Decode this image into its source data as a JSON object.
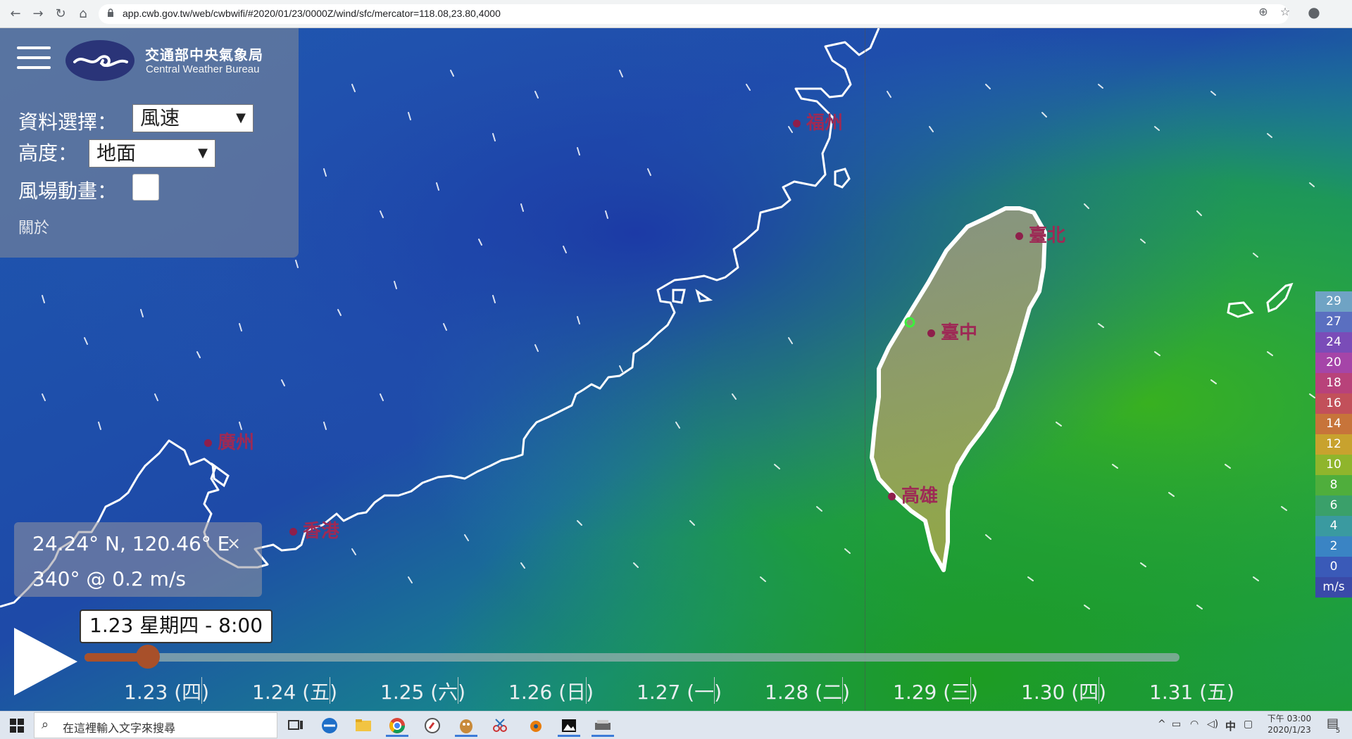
{
  "browser": {
    "url": "app.cwb.gov.tw/web/cwbwifi/#2020/01/23/0000Z/wind/sfc/mercator=118.08,23.80,4000",
    "back_icon": "←",
    "forward_icon": "→",
    "reload_icon": "↻",
    "home_icon": "⌂",
    "zoom_icon": "⊕",
    "star_icon": "☆",
    "profile_icon": "●"
  },
  "panel": {
    "org_name_zh": "交通部中央氣象局",
    "org_name_en": "Central Weather Bureau",
    "data_select_label": "資料選擇：",
    "data_select_value": "風速",
    "height_label": "高度：",
    "height_value": "地面",
    "animation_label": "風場動畫：",
    "about_label": "關於"
  },
  "cities": {
    "fuzhou": "福州",
    "guangzhou": "廣州",
    "hongkong": "香港",
    "taipei": "臺北",
    "taichung": "臺中",
    "kaohsiung": "高雄"
  },
  "info": {
    "coordinates": "24.24° N, 120.46° E",
    "close_icon": "×",
    "wind": "340° @ 0.2 m/s"
  },
  "timeline": {
    "current_time": "1.23 星期四 - 8:00",
    "progress": 0.05,
    "days": [
      "1.23 (四)",
      "1.24 (五)",
      "1.25 (六)",
      "1.26 (日)",
      "1.27 (一)",
      "1.28 (二)",
      "1.29 (三)",
      "1.30 (四)",
      "1.31 (五)"
    ]
  },
  "legend": {
    "steps": [
      {
        "label": "29",
        "color": "#6fa3c4"
      },
      {
        "label": "27",
        "color": "#5a6fc0"
      },
      {
        "label": "24",
        "color": "#7a4cb8"
      },
      {
        "label": "20",
        "color": "#a545a8"
      },
      {
        "label": "18",
        "color": "#b8427a"
      },
      {
        "label": "16",
        "color": "#c2505a"
      },
      {
        "label": "14",
        "color": "#c7743a"
      },
      {
        "label": "12",
        "color": "#c8a22e"
      },
      {
        "label": "10",
        "color": "#8fb52c"
      },
      {
        "label": "8",
        "color": "#4fae3c"
      },
      {
        "label": "6",
        "color": "#3aa06a"
      },
      {
        "label": "4",
        "color": "#3a9aa0"
      },
      {
        "label": "2",
        "color": "#3a84c4"
      },
      {
        "label": "0",
        "color": "#3a5ab8"
      }
    ],
    "unit": "m/s"
  },
  "taskbar": {
    "search_placeholder": "在這裡輸入文字來搜尋",
    "search_icon": "⌕",
    "ime": "中",
    "time_ampm": "下午 03:00",
    "date": "2020/1/23",
    "notifications": "5"
  }
}
